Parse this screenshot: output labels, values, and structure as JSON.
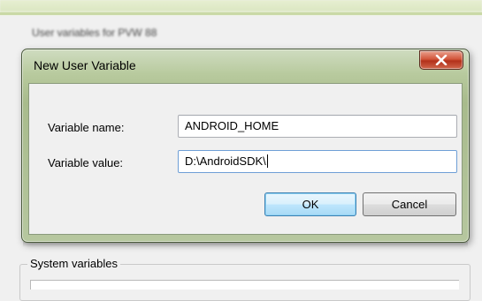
{
  "dialog": {
    "title": "New User Variable",
    "close_icon": "close-x-icon",
    "fields": {
      "name_label": "Variable name:",
      "name_value": "ANDROID_HOME",
      "value_label": "Variable value:",
      "value_value": "D:\\AndroidSDK\\"
    },
    "buttons": {
      "ok": "OK",
      "cancel": "Cancel"
    }
  },
  "parent": {
    "ghost_heading": "User variables for PVW 88",
    "system_variables_label": "System variables"
  },
  "colors": {
    "title_bar": "#b8ca9e",
    "close_button": "#c8452a",
    "default_button_border": "#3c7fb1",
    "focus_border": "#6f9fd6"
  }
}
